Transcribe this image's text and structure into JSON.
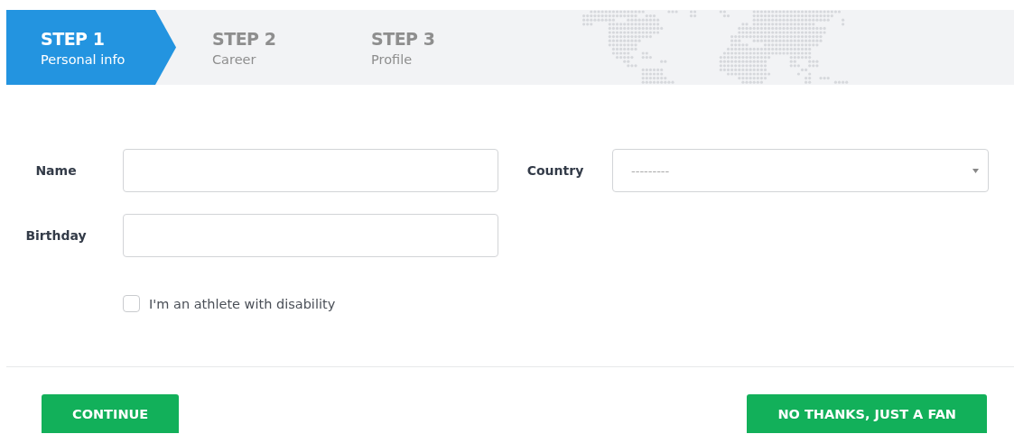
{
  "steps": [
    {
      "title": "STEP 1",
      "subtitle": "Personal info",
      "selected": true
    },
    {
      "title": "STEP 2",
      "subtitle": "Career",
      "selected": false
    },
    {
      "title": "STEP 3",
      "subtitle": "Profile",
      "selected": false
    }
  ],
  "form": {
    "name": {
      "label": "Name"
    },
    "country": {
      "label": "Country",
      "value": "---------"
    },
    "birthday": {
      "label": "Birthday"
    },
    "disability": {
      "label": "I'm an athlete with disability",
      "checked": false
    }
  },
  "buttons": [
    {
      "label": "CONTINUE"
    },
    {
      "label": "NO THANKS, JUST A FAN"
    }
  ]
}
